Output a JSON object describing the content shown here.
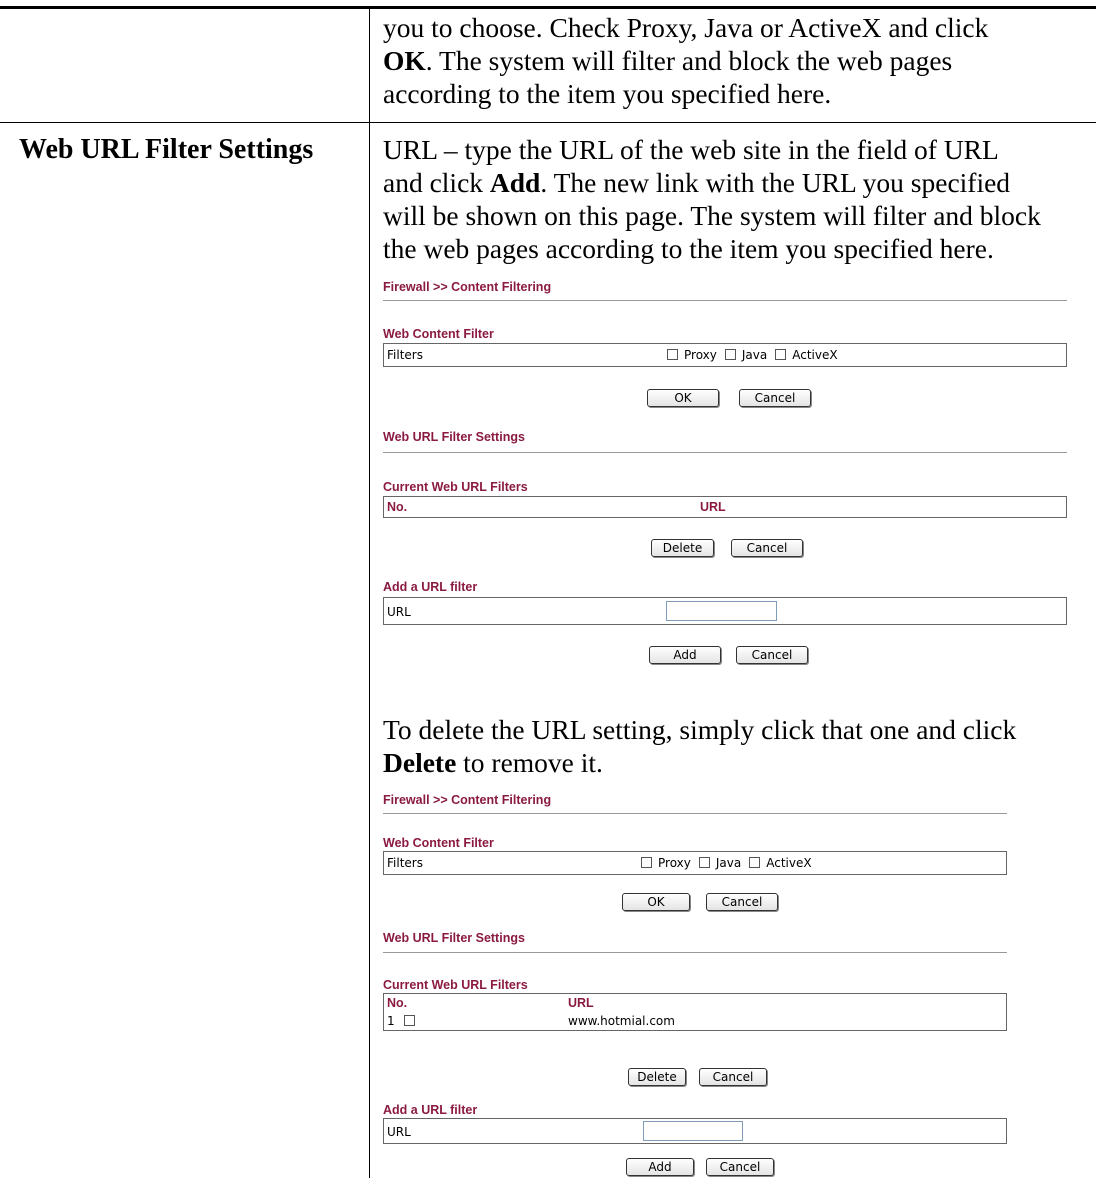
{
  "intro_lines": [
    "you to choose. Check Proxy, Java or ActiveX and click",
    "The system will filter and block the web pages",
    "according to the item you specified here."
  ],
  "intro_bold": "OK",
  "intro_bold_suffix": ". The system will filter and block the web pages",
  "row_label": "Web URL Filter Settings",
  "desc_lines": [
    "URL – type the URL of the web site in the field of URL",
    "and click",
    ". The new link with the URL you specified",
    "will be shown on this page. The system will filter and block",
    "the web pages according to the item you specified here."
  ],
  "desc_bold": "Add",
  "delete_lines": [
    "To delete the URL setting, simply click that one and click",
    " to remove it."
  ],
  "delete_bold": "Delete",
  "ui": {
    "breadcrumb": "Firewall >> Content Filtering",
    "web_content_filter": "Web Content Filter",
    "filters_label": "Filters",
    "opt_proxy": "Proxy",
    "opt_java": "Java",
    "opt_activex": "ActiveX",
    "ok": "OK",
    "cancel": "Cancel",
    "web_url_filter_settings": "Web URL Filter Settings",
    "current_filters": "Current Web URL Filters",
    "col_no": "No.",
    "col_url": "URL",
    "delete": "Delete",
    "add_filter": "Add a URL filter",
    "url_label": "URL",
    "add": "Add",
    "row1_no": "1",
    "row1_url": "www.hotmial.com"
  }
}
